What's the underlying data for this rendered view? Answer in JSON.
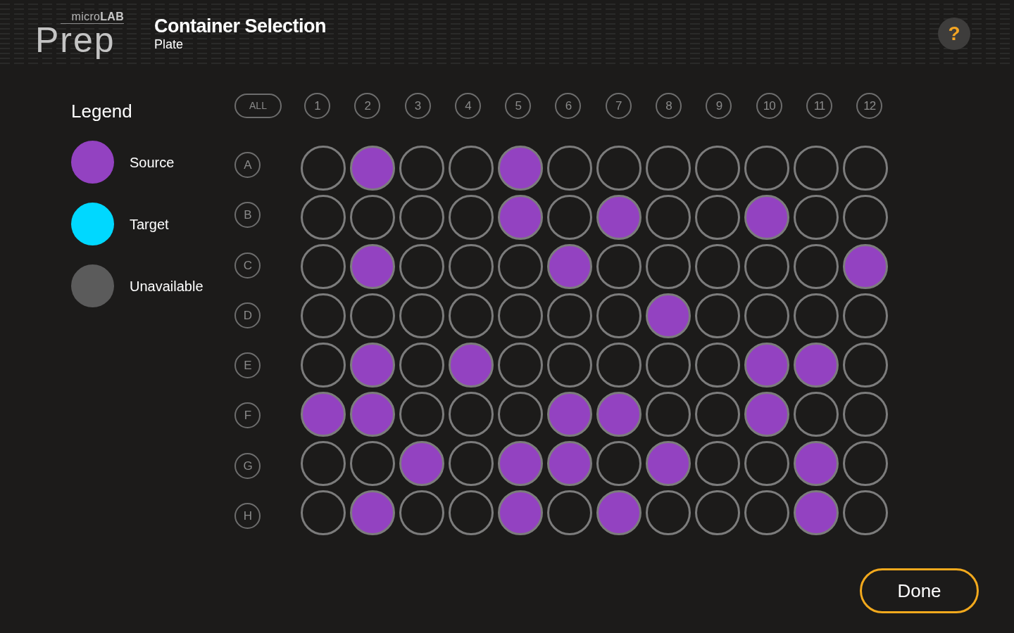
{
  "header": {
    "logo": {
      "small": "micro**LAB**",
      "large": "Prep"
    },
    "title": "Container Selection",
    "subtitle": "Plate",
    "help_button": {
      "label": "?"
    }
  },
  "legend": {
    "title": "Legend",
    "items": [
      {
        "label": "Source",
        "color": "#9342c1"
      },
      {
        "label": "Target",
        "color": "#00d8ff"
      },
      {
        "label": "Unavailable",
        "color": "#5b5b5b"
      }
    ]
  },
  "plate": {
    "select_all": {
      "label": "ALL"
    },
    "columns": [
      "1",
      "2",
      "3",
      "4",
      "5",
      "6",
      "7",
      "8",
      "9",
      "10",
      "11",
      "12"
    ],
    "rows": [
      {
        "label": "A",
        "wells": [
          {
            "selected": false
          },
          {
            "selected": true
          },
          {
            "selected": false
          },
          {
            "selected": false
          },
          {
            "selected": true
          },
          {
            "selected": false
          },
          {
            "selected": false
          },
          {
            "selected": false
          },
          {
            "selected": false
          },
          {
            "selected": false
          },
          {
            "selected": false
          },
          {
            "selected": false
          }
        ]
      },
      {
        "label": "B",
        "wells": [
          {
            "selected": false
          },
          {
            "selected": false
          },
          {
            "selected": false
          },
          {
            "selected": false
          },
          {
            "selected": true
          },
          {
            "selected": false
          },
          {
            "selected": true
          },
          {
            "selected": false
          },
          {
            "selected": false
          },
          {
            "selected": true
          },
          {
            "selected": false
          },
          {
            "selected": false
          }
        ]
      },
      {
        "label": "C",
        "wells": [
          {
            "selected": false
          },
          {
            "selected": true
          },
          {
            "selected": false
          },
          {
            "selected": false
          },
          {
            "selected": false
          },
          {
            "selected": true
          },
          {
            "selected": false
          },
          {
            "selected": false
          },
          {
            "selected": false
          },
          {
            "selected": false
          },
          {
            "selected": false
          },
          {
            "selected": true
          }
        ]
      },
      {
        "label": "D",
        "wells": [
          {
            "selected": false
          },
          {
            "selected": false
          },
          {
            "selected": false
          },
          {
            "selected": false
          },
          {
            "selected": false
          },
          {
            "selected": false
          },
          {
            "selected": false
          },
          {
            "selected": true
          },
          {
            "selected": false
          },
          {
            "selected": false
          },
          {
            "selected": false
          },
          {
            "selected": false
          }
        ]
      },
      {
        "label": "E",
        "wells": [
          {
            "selected": false
          },
          {
            "selected": true
          },
          {
            "selected": false
          },
          {
            "selected": true
          },
          {
            "selected": false
          },
          {
            "selected": false
          },
          {
            "selected": false
          },
          {
            "selected": false
          },
          {
            "selected": false
          },
          {
            "selected": true
          },
          {
            "selected": true
          },
          {
            "selected": false
          }
        ]
      },
      {
        "label": "F",
        "wells": [
          {
            "selected": true
          },
          {
            "selected": true
          },
          {
            "selected": false
          },
          {
            "selected": false
          },
          {
            "selected": false
          },
          {
            "selected": true
          },
          {
            "selected": true
          },
          {
            "selected": false
          },
          {
            "selected": false
          },
          {
            "selected": true
          },
          {
            "selected": false
          },
          {
            "selected": false
          }
        ]
      },
      {
        "label": "G",
        "wells": [
          {
            "selected": false
          },
          {
            "selected": false
          },
          {
            "selected": true
          },
          {
            "selected": false
          },
          {
            "selected": true
          },
          {
            "selected": true
          },
          {
            "selected": false
          },
          {
            "selected": true
          },
          {
            "selected": false
          },
          {
            "selected": false
          },
          {
            "selected": true
          },
          {
            "selected": false
          }
        ]
      },
      {
        "label": "H",
        "wells": [
          {
            "selected": false
          },
          {
            "selected": true
          },
          {
            "selected": false
          },
          {
            "selected": false
          },
          {
            "selected": true
          },
          {
            "selected": false
          },
          {
            "selected": true
          },
          {
            "selected": false
          },
          {
            "selected": false
          },
          {
            "selected": false
          },
          {
            "selected": true
          },
          {
            "selected": false
          }
        ]
      }
    ]
  },
  "done_button": {
    "label": "Done"
  }
}
